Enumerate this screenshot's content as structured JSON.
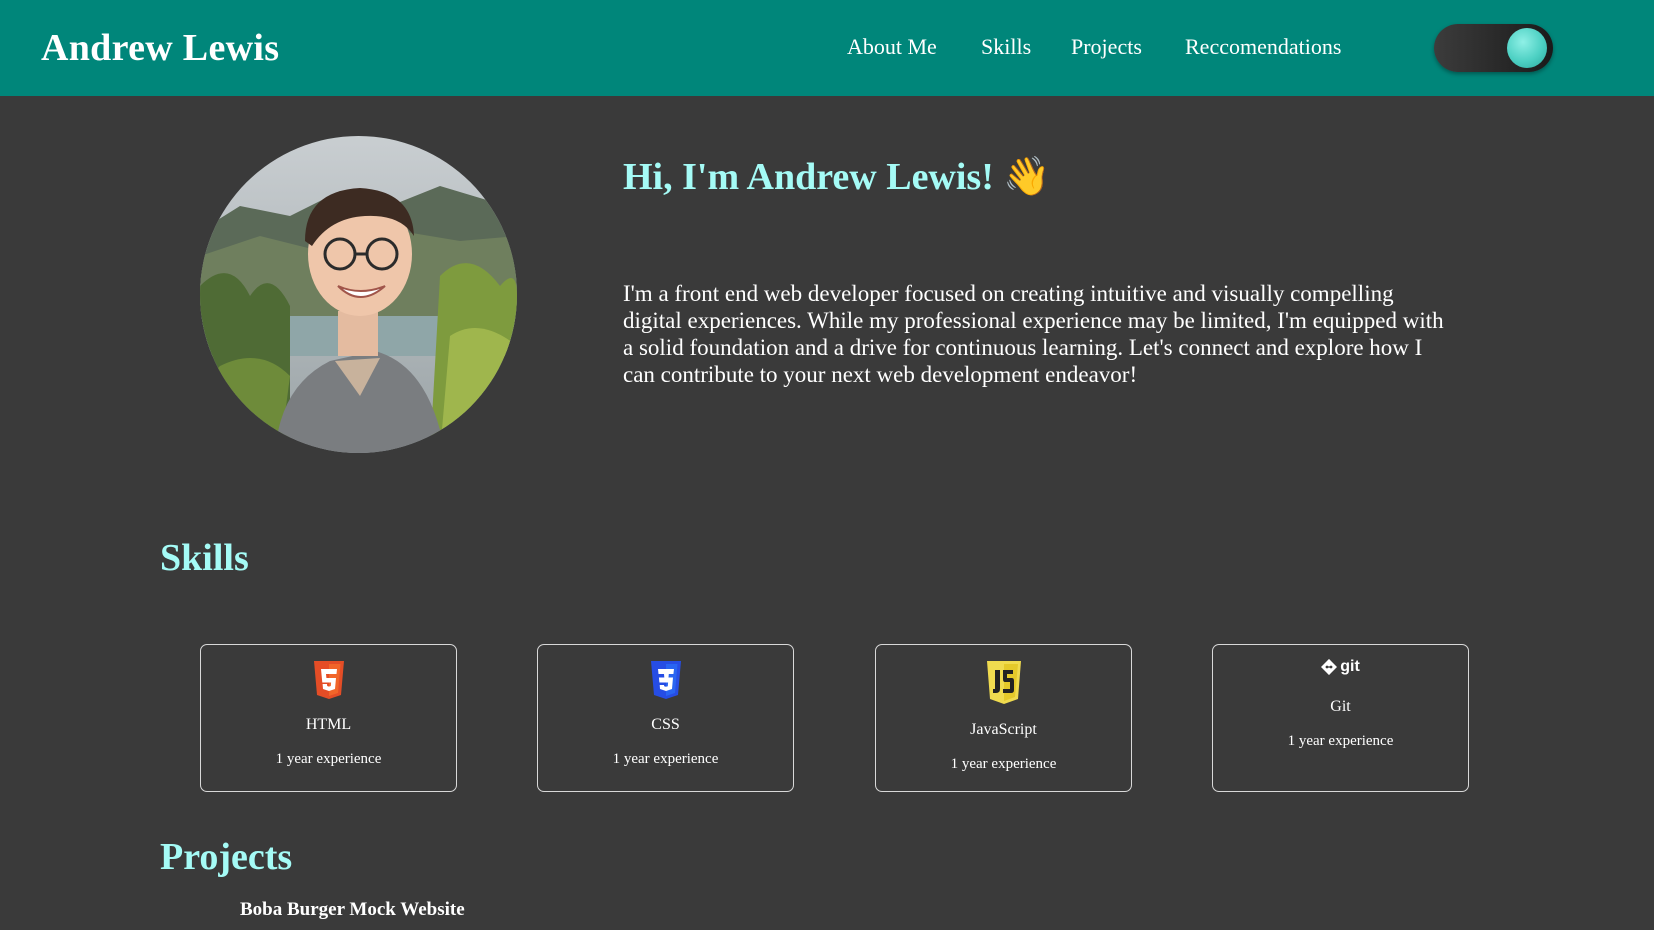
{
  "header": {
    "brand": "Andrew Lewis",
    "nav": [
      {
        "label": "About Me"
      },
      {
        "label": "Skills"
      },
      {
        "label": "Projects"
      },
      {
        "label": "Reccomendations"
      }
    ],
    "theme_toggle": {
      "state": "on"
    }
  },
  "about": {
    "greeting": "Hi, I'm Andrew Lewis!",
    "wave_emoji": "👋",
    "bio": "I'm a front end web developer focused on creating intuitive and visually compelling digital experiences. While my professional experience may be limited, I'm equipped with a solid foundation and a drive for continuous learning. Let's connect and explore how I can contribute to your next web development endeavor!"
  },
  "skills": {
    "title": "Skills",
    "items": [
      {
        "name": "HTML",
        "experience": "1 year experience",
        "icon": "html5-icon",
        "color": "#e44d26"
      },
      {
        "name": "CSS",
        "experience": "1 year experience",
        "icon": "css3-icon",
        "color": "#264de4"
      },
      {
        "name": "JavaScript",
        "experience": "1 year experience",
        "icon": "javascript-icon",
        "color": "#f0db4f"
      },
      {
        "name": "Git",
        "experience": "1 year experience",
        "icon": "git-icon",
        "icon_text": "git"
      }
    ]
  },
  "projects": {
    "title": "Projects",
    "items": [
      {
        "title": "Boba Burger Mock Website"
      }
    ]
  },
  "colors": {
    "header_bg": "#00867a",
    "page_bg": "#3a3a3a",
    "heading": "#a5fbf6",
    "toggle_knob": "#4dd0c3"
  }
}
